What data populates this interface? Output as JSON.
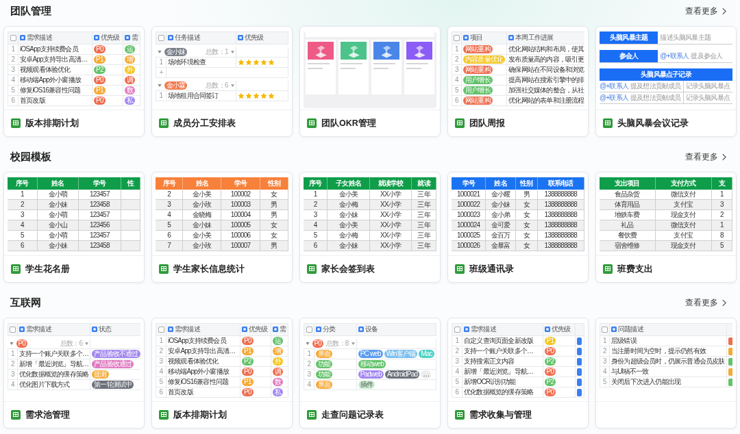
{
  "sections": [
    {
      "title": "团队管理",
      "more": "查看更多",
      "templates": [
        {
          "title": "版本排期计划",
          "preview": {
            "kind": "table",
            "columns": [
              {
                "kind": "checkbox",
                "checked": false
              },
              {
                "kind": "field",
                "label": "需求描述"
              },
              {
                "kind": "field",
                "label": "优先级"
              },
              {
                "kind": "field",
                "label": "需"
              }
            ],
            "rows": [
              {
                "cells": [
                  {
                    "kind": "text",
                    "text": "1"
                  },
                  {
                    "kind": "text",
                    "text": "iOSApp支持续费会员"
                  },
                  {
                    "kind": "tag",
                    "text": "P0",
                    "color": "#ef6d4f"
                  },
                  {
                    "kind": "tag",
                    "text": "运",
                    "color": "#63c26a"
                  }
                ]
              },
              {
                "cells": [
                  {
                    "kind": "text",
                    "text": "2"
                  },
                  {
                    "kind": "text",
                    "text": "安卓App支持导出高清…"
                  },
                  {
                    "kind": "tag",
                    "text": "P1",
                    "color": "#f7a935"
                  },
                  {
                    "kind": "tag",
                    "text": "增",
                    "color": "#f7a935"
                  }
                ]
              },
              {
                "cells": [
                  {
                    "kind": "text",
                    "text": "3"
                  },
                  {
                    "kind": "text",
                    "text": "视频观看体验优化"
                  },
                  {
                    "kind": "tag",
                    "text": "P2",
                    "color": "#63c26a"
                  },
                  {
                    "kind": "tag",
                    "text": "外",
                    "color": "#f3c623"
                  }
                ]
              },
              {
                "cells": [
                  {
                    "kind": "text",
                    "text": "4"
                  },
                  {
                    "kind": "text",
                    "text": "移动端App外小窗播放"
                  },
                  {
                    "kind": "tag",
                    "text": "P0",
                    "color": "#ef6d4f"
                  },
                  {
                    "kind": "tag",
                    "text": "调",
                    "color": "#ef6d4f"
                  }
                ]
              },
              {
                "cells": [
                  {
                    "kind": "text",
                    "text": "5"
                  },
                  {
                    "kind": "text",
                    "text": "修复iOS16兼容性问题"
                  },
                  {
                    "kind": "tag",
                    "text": "P1",
                    "color": "#f7a935"
                  },
                  {
                    "kind": "tag",
                    "text": "数",
                    "color": "#e07bc0"
                  }
                ]
              },
              {
                "cells": [
                  {
                    "kind": "text",
                    "text": "6"
                  },
                  {
                    "kind": "text",
                    "text": "首页改版"
                  },
                  {
                    "kind": "tag",
                    "text": "P0",
                    "color": "#ef6d4f"
                  },
                  {
                    "kind": "tag",
                    "text": "私",
                    "color": "#a287f0"
                  }
                ]
              }
            ]
          }
        },
        {
          "title": "成员分工安排表",
          "preview": {
            "kind": "grouped",
            "columns": [
              {
                "kind": "checkbox",
                "checked": false
              },
              {
                "kind": "field",
                "label": "任务描述"
              },
              {
                "kind": "field",
                "label": "优先级"
              }
            ],
            "groups": [
              {
                "tag": "金小妹",
                "color": "#7b808a",
                "count": "总数：1",
                "add_row": "+",
                "rows": [
                  {
                    "cells": [
                      {
                        "kind": "text",
                        "text": "1"
                      },
                      {
                        "kind": "text",
                        "text": "场地环境检查"
                      },
                      {
                        "kind": "stars",
                        "stars": 5
                      }
                    ]
                  }
                ]
              },
              {
                "tag": "金小霖",
                "color": "#f07a4f",
                "count": "总数：6",
                "rows": [
                  {
                    "cells": [
                      {
                        "kind": "text",
                        "text": "1"
                      },
                      {
                        "kind": "text",
                        "text": "场地租用合同签订"
                      },
                      {
                        "kind": "stars",
                        "stars": 5
                      }
                    ]
                  }
                ]
              }
            ]
          }
        },
        {
          "title": "团队OKR管理",
          "preview": {
            "kind": "gallery",
            "tiles": [
              {
                "color": "#ee5a86"
              },
              {
                "color": "#4cc38a"
              },
              {
                "color": "#4a86e8"
              },
              {
                "color": "#8b5cf6"
              }
            ]
          }
        },
        {
          "title": "团队周报",
          "preview": {
            "kind": "table",
            "columns": [
              {
                "kind": "checkbox",
                "checked": false
              },
              {
                "kind": "field",
                "label": "项目"
              },
              {
                "kind": "field",
                "label": "本周工作进展"
              }
            ],
            "rows": [
              {
                "cells": [
                  {
                    "kind": "text",
                    "text": "1"
                  },
                  {
                    "kind": "tag",
                    "text": "网站重构",
                    "color": "#ef6d4f"
                  },
                  {
                    "kind": "text",
                    "text": "优化网站结构和布局，使其"
                  }
                ]
              },
              {
                "cells": [
                  {
                    "kind": "text",
                    "text": "2"
                  },
                  {
                    "kind": "tag",
                    "text": "内容质量优化",
                    "color": "#f3c623"
                  },
                  {
                    "kind": "text",
                    "text": "发布质量高的内容，吸引更"
                  }
                ]
              },
              {
                "cells": [
                  {
                    "kind": "text",
                    "text": "3"
                  },
                  {
                    "kind": "tag",
                    "text": "网站重构",
                    "color": "#ef6d4f"
                  },
                  {
                    "kind": "text",
                    "text": "确保网站在不同设备和浏览"
                  }
                ]
              },
              {
                "cells": [
                  {
                    "kind": "text",
                    "text": "4"
                  },
                  {
                    "kind": "tag",
                    "text": "用户增长",
                    "color": "#63c26a"
                  },
                  {
                    "kind": "text",
                    "text": "提高网站在搜索引擎中的排"
                  }
                ]
              },
              {
                "cells": [
                  {
                    "kind": "text",
                    "text": "5"
                  },
                  {
                    "kind": "tag",
                    "text": "用户增长",
                    "color": "#63c26a"
                  },
                  {
                    "kind": "text",
                    "text": "加强社交媒体的整合，从社"
                  }
                ]
              },
              {
                "cells": [
                  {
                    "kind": "text",
                    "text": "6"
                  },
                  {
                    "kind": "tag",
                    "text": "网站重构",
                    "color": "#ef6d4f"
                  },
                  {
                    "kind": "text",
                    "text": "优化网站的表单和注册流程"
                  }
                ]
              }
            ]
          }
        },
        {
          "title": "头脑风暴会议记录",
          "preview": {
            "kind": "form",
            "fields": [
              {
                "label": "头脑风暴主题",
                "value": "描述头脑风暴主题"
              },
              {
                "label": "参会人",
                "link": "@+联系人",
                "value": "提及参会人"
              }
            ],
            "section": {
              "title": "头脑风暴点子记录",
              "rows": [
                {
                  "link": "@+联系人",
                  "text": "提及想法贡献成员",
                  "value": "记录头脑风暴点"
                },
                {
                  "link": "@+联系人",
                  "text": "提及想法贡献成员",
                  "value": "记录头脑风暴点"
                }
              ]
            }
          }
        }
      ]
    },
    {
      "title": "校园模板",
      "more": "查看更多",
      "templates": [
        {
          "title": "学生花名册",
          "preview": {
            "kind": "banded",
            "color": "#0f9d4a",
            "columns": [
              "序号",
              "姓名",
              "学号",
              "性"
            ],
            "rows": [
              [
                "1",
                "金小萌",
                "123457"
              ],
              [
                "2",
                "金小妹",
                "123458"
              ],
              [
                "3",
                "金小萌",
                "123457"
              ],
              [
                "4",
                "金小山",
                "123456"
              ],
              [
                "5",
                "金小萌",
                "123457"
              ],
              [
                "6",
                "金小妹",
                "123458"
              ]
            ]
          }
        },
        {
          "title": "学生家长信息统计",
          "preview": {
            "kind": "banded",
            "color": "#f7803a",
            "columns": [
              "序号",
              "姓名",
              "学号",
              "性别"
            ],
            "rows": [
              [
                "2",
                "金小美",
                "100002",
                "女"
              ],
              [
                "3",
                "金小玫",
                "100003",
                "男"
              ],
              [
                "4",
                "金晓梅",
                "100004",
                "男"
              ],
              [
                "5",
                "金小妹",
                "100005",
                "女"
              ],
              [
                "6",
                "金小美",
                "100006",
                "女"
              ],
              [
                "7",
                "金小玫",
                "100007",
                "男"
              ]
            ]
          }
        },
        {
          "title": "家长会签到表",
          "preview": {
            "kind": "banded",
            "color": "#0f9d4a",
            "columns": [
              "序号",
              "子女姓名",
              "就读学校",
              "就读"
            ],
            "rows": [
              [
                "1",
                "金小美",
                "XX小学",
                "三年"
              ],
              [
                "2",
                "金小梅",
                "XX小学",
                "三年"
              ],
              [
                "3",
                "金小妹",
                "XX小学",
                "三年"
              ],
              [
                "4",
                "金小美",
                "XX小学",
                "三年"
              ],
              [
                "5",
                "金小梅",
                "XX小学",
                "三年"
              ],
              [
                "6",
                "金小妹",
                "XX小学",
                "三年"
              ]
            ]
          }
        },
        {
          "title": "班级通讯录",
          "preview": {
            "kind": "banded",
            "color": "#1a73f0",
            "columns": [
              "学号",
              "姓名",
              "性别",
              "联系电话"
            ],
            "rows": [
              [
                "1000021",
                "金小耀",
                "男",
                "1388888888"
              ],
              [
                "1000022",
                "金小妹",
                "女",
                "1388888888"
              ],
              [
                "1000023",
                "金小弟",
                "女",
                "1388888888"
              ],
              [
                "1000024",
                "金可爱",
                "女",
                "1388888888"
              ],
              [
                "1000025",
                "金百万",
                "女",
                "1388888888"
              ],
              [
                "1000026",
                "金暴富",
                "女",
                "1388888888"
              ]
            ]
          }
        },
        {
          "title": "班费支出",
          "preview": {
            "kind": "banded",
            "color": "#0f9d4a",
            "columns": [
              "支出项目",
              "支付方式",
              "支"
            ],
            "rows": [
              [
                "食品杂货",
                "微信支付",
                "1"
              ],
              [
                "体育用品",
                "支付宝",
                "3"
              ],
              [
                "地铁车费",
                "现金支付",
                "2"
              ],
              [
                "礼品",
                "微信支付",
                "1"
              ],
              [
                "餐饮费",
                "支付宝",
                "8"
              ],
              [
                "宿舍维修",
                "现金支付",
                "5"
              ]
            ]
          }
        }
      ]
    },
    {
      "title": "互联网",
      "more": "查看更多",
      "templates": [
        {
          "title": "需求池管理",
          "preview": {
            "kind": "grouped",
            "columns": [
              {
                "kind": "checkbox",
                "checked": false
              },
              {
                "kind": "field",
                "label": "需求描述"
              },
              {
                "kind": "field",
                "label": "状态"
              }
            ],
            "groups": [
              {
                "tag": "P0",
                "color": "#ef6d4f",
                "count": "总数：6",
                "rows": [
                  {
                    "cells": [
                      {
                        "kind": "text",
                        "text": "1"
                      },
                      {
                        "kind": "text",
                        "text": "支持一个账户关联多个…"
                      },
                      {
                        "kind": "tag",
                        "text": "产品验收不通过",
                        "color": "#a287f0"
                      }
                    ]
                  },
                  {
                    "cells": [
                      {
                        "kind": "text",
                        "text": "2"
                      },
                      {
                        "kind": "text",
                        "text": "新增「最近浏览」导航…"
                      },
                      {
                        "kind": "tag",
                        "text": "产品验收通过",
                        "color": "#e07bc0"
                      }
                    ]
                  },
                  {
                    "cells": [
                      {
                        "kind": "text",
                        "text": "3"
                      },
                      {
                        "kind": "text",
                        "text": "优化数据概览的缓存策略"
                      },
                      {
                        "kind": "tag",
                        "text": "提测",
                        "color": "#f7a935"
                      }
                    ]
                  },
                  {
                    "cells": [
                      {
                        "kind": "text",
                        "text": "4"
                      },
                      {
                        "kind": "text",
                        "text": "优化图片下载方式"
                      },
                      {
                        "kind": "tag",
                        "text": "第一轮测试中",
                        "color": "#6b7079"
                      }
                    ]
                  }
                ]
              }
            ]
          }
        },
        {
          "title": "版本排期计划",
          "preview": {
            "kind": "table",
            "columns": [
              {
                "kind": "checkbox",
                "checked": false
              },
              {
                "kind": "field",
                "label": "需求描述"
              },
              {
                "kind": "field",
                "label": "优先级"
              },
              {
                "kind": "field",
                "label": "需"
              }
            ],
            "rows": [
              {
                "cells": [
                  {
                    "kind": "text",
                    "text": "1"
                  },
                  {
                    "kind": "text",
                    "text": "iOSApp支持续费会员"
                  },
                  {
                    "kind": "tag",
                    "text": "P0",
                    "color": "#ef6d4f"
                  },
                  {
                    "kind": "tag",
                    "text": "运",
                    "color": "#63c26a"
                  }
                ]
              },
              {
                "cells": [
                  {
                    "kind": "text",
                    "text": "2"
                  },
                  {
                    "kind": "text",
                    "text": "安卓App支持导出高清…"
                  },
                  {
                    "kind": "tag",
                    "text": "P1",
                    "color": "#f7a935"
                  },
                  {
                    "kind": "tag",
                    "text": "增",
                    "color": "#f7a935"
                  }
                ]
              },
              {
                "cells": [
                  {
                    "kind": "text",
                    "text": "3"
                  },
                  {
                    "kind": "text",
                    "text": "视频观看体验优化"
                  },
                  {
                    "kind": "tag",
                    "text": "P2",
                    "color": "#63c26a"
                  },
                  {
                    "kind": "tag",
                    "text": "外",
                    "color": "#f3c623"
                  }
                ]
              },
              {
                "cells": [
                  {
                    "kind": "text",
                    "text": "4"
                  },
                  {
                    "kind": "text",
                    "text": "移动端App外小窗播放"
                  },
                  {
                    "kind": "tag",
                    "text": "P0",
                    "color": "#ef6d4f"
                  },
                  {
                    "kind": "tag",
                    "text": "调",
                    "color": "#ef6d4f"
                  }
                ]
              },
              {
                "cells": [
                  {
                    "kind": "text",
                    "text": "5"
                  },
                  {
                    "kind": "text",
                    "text": "修复iOS16兼容性问题"
                  },
                  {
                    "kind": "tag",
                    "text": "P1",
                    "color": "#f7a935"
                  },
                  {
                    "kind": "tag",
                    "text": "数",
                    "color": "#e07bc0"
                  }
                ]
              },
              {
                "cells": [
                  {
                    "kind": "text",
                    "text": "6"
                  },
                  {
                    "kind": "text",
                    "text": "首页改版"
                  },
                  {
                    "kind": "tag",
                    "text": "P0",
                    "color": "#ef6d4f"
                  },
                  {
                    "kind": "tag",
                    "text": "私",
                    "color": "#a287f0"
                  }
                ]
              }
            ]
          }
        },
        {
          "title": "走查问题记录表",
          "preview": {
            "kind": "grouped",
            "columns": [
              {
                "kind": "checkbox",
                "checked": false
              },
              {
                "kind": "field",
                "label": "分类"
              },
              {
                "kind": "field",
                "label": "设备"
              }
            ],
            "groups": [
              {
                "tag": "P0",
                "color": "#ef6d4f",
                "count": "总数：8",
                "rows": [
                  {
                    "cells": [
                      {
                        "kind": "text",
                        "text": "1"
                      },
                      {
                        "kind": "tag",
                        "text": "界面",
                        "color": "#f7a935"
                      },
                      {
                        "kind": "tags",
                        "items": [
                          {
                            "text": "PC web",
                            "color": "#5b9cf0"
                          },
                          {
                            "text": "Win客户端",
                            "color": "#7cc0ef"
                          },
                          {
                            "text": "Mac",
                            "color": "#4fd1c5"
                          }
                        ]
                      }
                    ]
                  },
                  {
                    "cells": [
                      {
                        "kind": "text",
                        "text": "2"
                      },
                      {
                        "kind": "tag",
                        "text": "功能",
                        "color": "#63c26a"
                      },
                      {
                        "kind": "tags",
                        "items": [
                          {
                            "text": "移动web",
                            "color": "#63c26a"
                          }
                        ]
                      }
                    ]
                  },
                  {
                    "cells": [
                      {
                        "kind": "text",
                        "text": "3"
                      },
                      {
                        "kind": "tag",
                        "text": "功能",
                        "color": "#63c26a"
                      },
                      {
                        "kind": "tags",
                        "items": [
                          {
                            "text": "Padweb",
                            "color": "#a287f0"
                          },
                          {
                            "text": "AndroidPad",
                            "color": "#6b7079"
                          },
                          {
                            "text": "…",
                            "color": "#eeeeee"
                          }
                        ]
                      }
                    ]
                  },
                  {
                    "cells": [
                      {
                        "kind": "text",
                        "text": "4"
                      },
                      {
                        "kind": "tag",
                        "text": "界面",
                        "color": "#f7a935"
                      },
                      {
                        "kind": "tags",
                        "items": [
                          {
                            "text": "插件",
                            "color": "#c8ecd0"
                          }
                        ]
                      }
                    ]
                  }
                ]
              }
            ]
          }
        },
        {
          "title": "需求收集与管理",
          "preview": {
            "kind": "table",
            "columns": [
              {
                "kind": "checkbox",
                "checked": false
              },
              {
                "kind": "field",
                "label": "需求描述"
              },
              {
                "kind": "field",
                "label": "优先级"
              }
            ],
            "rows": [
              {
                "cells": [
                  {
                    "kind": "text",
                    "text": "1"
                  },
                  {
                    "kind": "text",
                    "text": "自定义查询页面全新改版"
                  },
                  {
                    "kind": "tag",
                    "text": "P1",
                    "color": "#f3c623"
                  },
                  {
                    "kind": "chip",
                    "color": "#3b7ff0"
                  }
                ]
              },
              {
                "cells": [
                  {
                    "kind": "text",
                    "text": "2"
                  },
                  {
                    "kind": "text",
                    "text": "支持一个账户关联多个…"
                  },
                  {
                    "kind": "tag",
                    "text": "P0",
                    "color": "#ef6d4f"
                  },
                  {
                    "kind": "chip",
                    "color": "#3b7ff0"
                  }
                ]
              },
              {
                "cells": [
                  {
                    "kind": "text",
                    "text": "3"
                  },
                  {
                    "kind": "text",
                    "text": "支持搜索正文内容"
                  },
                  {
                    "kind": "tag",
                    "text": "P2",
                    "color": "#63c26a"
                  },
                  {
                    "kind": "chip",
                    "color": "#3b7ff0"
                  }
                ]
              },
              {
                "cells": [
                  {
                    "kind": "text",
                    "text": "4"
                  },
                  {
                    "kind": "text",
                    "text": "新增「最近浏览」导航…"
                  },
                  {
                    "kind": "tag",
                    "text": "P0",
                    "color": "#ef6d4f"
                  },
                  {
                    "kind": "chip",
                    "color": "#3b7ff0"
                  }
                ]
              },
              {
                "cells": [
                  {
                    "kind": "text",
                    "text": "5"
                  },
                  {
                    "kind": "text",
                    "text": "新增OCR识别功能"
                  },
                  {
                    "kind": "tag",
                    "text": "P2",
                    "color": "#63c26a"
                  },
                  {
                    "kind": "chip",
                    "color": "#3b7ff0"
                  }
                ]
              },
              {
                "cells": [
                  {
                    "kind": "text",
                    "text": "6"
                  },
                  {
                    "kind": "text",
                    "text": "优化数据概览的缓存策略"
                  },
                  {
                    "kind": "tag",
                    "text": "P0",
                    "color": "#ef6d4f"
                  },
                  {
                    "kind": "chip",
                    "color": "#3b7ff0"
                  }
                ]
              }
            ]
          }
        },
        {
          "preview": {
            "kind": "table",
            "columns": [
              {
                "kind": "checkbox",
                "checked": false
              },
              {
                "kind": "field",
                "label": "问题描述"
              }
            ],
            "rows": [
              {
                "cells": [
                  {
                    "kind": "text",
                    "text": "1"
                  },
                  {
                    "kind": "text",
                    "text": "层级错误"
                  },
                  {
                    "kind": "chip",
                    "color": "#ef6d4f"
                  }
                ]
              },
              {
                "cells": [
                  {
                    "kind": "text",
                    "text": "2"
                  },
                  {
                    "kind": "text",
                    "text": "当注册时间为空时，提示仍然有效"
                  },
                  {
                    "kind": "chip",
                    "color": "#f7a935"
                  }
                ]
              },
              {
                "cells": [
                  {
                    "kind": "text",
                    "text": "3"
                  },
                  {
                    "kind": "text",
                    "text": "身份为超级会员时，仍展示普通会员皮肤"
                  },
                  {
                    "kind": "chip",
                    "color": "#63c26a"
                  }
                ]
              },
              {
                "cells": [
                  {
                    "kind": "text",
                    "text": "4"
                  },
                  {
                    "kind": "text",
                    "text": "与UI稿不一致"
                  },
                  {
                    "kind": "chip",
                    "color": "#f7a935"
                  }
                ]
              },
              {
                "cells": [
                  {
                    "kind": "text",
                    "text": "5"
                  },
                  {
                    "kind": "text",
                    "text": "关闭后下次进入仍能出现"
                  },
                  {
                    "kind": "chip",
                    "color": "#63c26a"
                  }
                ]
              }
            ]
          }
        }
      ]
    }
  ]
}
